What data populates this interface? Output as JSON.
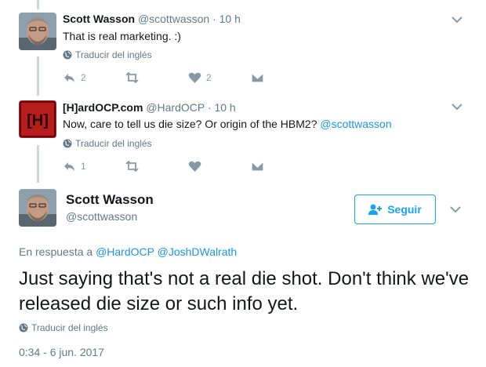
{
  "tweets": [
    {
      "name": "Scott Wasson",
      "handle": "@scottwasson",
      "dot": "·",
      "time": "10 h",
      "text": "That is real marketing. :)",
      "translate": "Traducir del inglés",
      "reply_count": "2",
      "retweet_count": "",
      "like_count": "2"
    },
    {
      "name": "[H]ardOCP.com",
      "handle": "@HardOCP",
      "dot": "·",
      "time": "10 h",
      "text_before": "Now, care to tell us die size?  Or origin of the HBM2? ",
      "text_mention": "@scottwasson",
      "translate": "Traducir del inglés",
      "reply_count": "1",
      "retweet_count": "",
      "like_count": ""
    }
  ],
  "main_tweet": {
    "name": "Scott Wasson",
    "handle": "@scottwasson",
    "follow_label": "Seguir",
    "reply_to_prefix": "En respuesta a ",
    "reply_to_mention1": "@HardOCP",
    "reply_to_mention2": "@JoshDWalrath",
    "text": "Just saying that's not a real die shot. Don't think we've released die size or such info yet.",
    "translate": "Traducir del inglés",
    "timestamp": "0:34 - 6 jun. 2017"
  },
  "colors": {
    "accent": "#1da1f2",
    "mention": "#1b95e0",
    "secondary_text": "#657786",
    "action_icon": "#8899a6",
    "thread_line": "#ccd6dd",
    "hardocp_avatar_bg": "#b81d1d"
  },
  "icons": {
    "translate": "globe-icon",
    "reply": "reply-icon",
    "retweet": "retweet-icon",
    "like": "heart-icon",
    "dm": "envelope-icon",
    "more": "chevron-down-icon",
    "follow": "add-user-icon"
  },
  "hardocp_avatar_text": "[H]"
}
